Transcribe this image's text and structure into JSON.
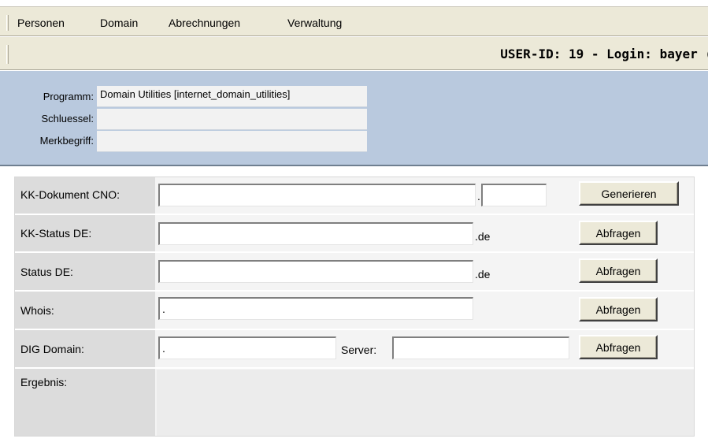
{
  "menu": {
    "items": [
      {
        "label": "Personen"
      },
      {
        "label": "Domain"
      },
      {
        "label": "Abrechnungen"
      },
      {
        "label": "Verwaltung"
      }
    ]
  },
  "header": {
    "user_info": "USER-ID: 19 - Login: bayer ("
  },
  "program_info": {
    "program_label": "Programm:",
    "program_value": "Domain Utilities [internet_domain_utilities]",
    "key_label": "Schluessel:",
    "key_value": "",
    "keyword_label": "Merkbegriff:",
    "keyword_value": ""
  },
  "form": {
    "kk_doc": {
      "label": "KK-Dokument CNO:",
      "value1": "",
      "separator": ".",
      "value2": "",
      "button": "Generieren"
    },
    "kk_status": {
      "label": "KK-Status DE:",
      "value": "",
      "suffix": ".de",
      "button": "Abfragen"
    },
    "status": {
      "label": "Status DE:",
      "value": "",
      "suffix": ".de",
      "button": "Abfragen"
    },
    "whois": {
      "label": "Whois:",
      "value": ".",
      "button": "Abfragen"
    },
    "dig": {
      "label": "DIG Domain:",
      "value": ".",
      "server_label": "Server:",
      "server_value": "",
      "button": "Abfragen"
    },
    "result": {
      "label": "Ergebnis:"
    }
  }
}
